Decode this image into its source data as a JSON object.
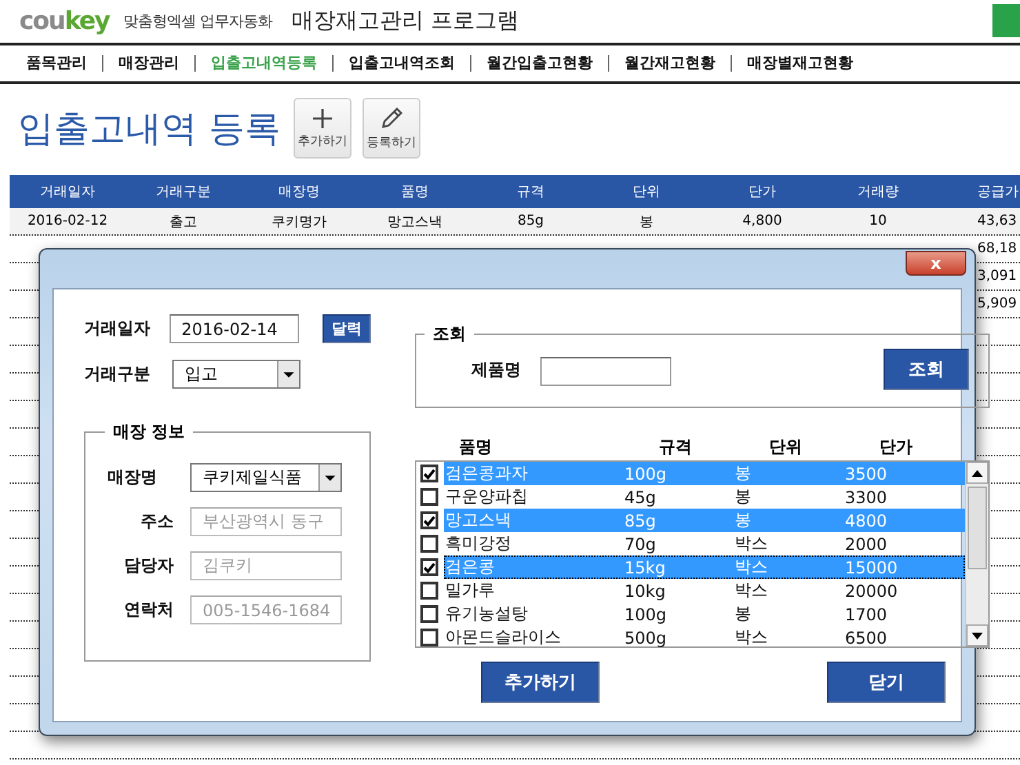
{
  "header": {
    "logo_gray": "cou",
    "logo_green": "key",
    "tagline": "맞춤형엑셀 업무자동화",
    "title": "매장재고관리 프로그램"
  },
  "nav": [
    {
      "label": "품목관리",
      "selected": false
    },
    {
      "label": "매장관리",
      "selected": false
    },
    {
      "label": "입출고내역등록",
      "selected": true
    },
    {
      "label": "입출고내역조회",
      "selected": false
    },
    {
      "label": "월간입출고현황",
      "selected": false
    },
    {
      "label": "월간재고현황",
      "selected": false
    },
    {
      "label": "매장별재고현황",
      "selected": false
    }
  ],
  "page_title": "입출고내역 등록",
  "toolbar": [
    {
      "kind": "add",
      "label": "추가하기"
    },
    {
      "kind": "edit",
      "label": "등록하기"
    }
  ],
  "table": {
    "columns": [
      "거래일자",
      "거래구분",
      "매장명",
      "품명",
      "규격",
      "단위",
      "단가",
      "거래량",
      "공급가"
    ],
    "rows": [
      {
        "cells": [
          "2016-02-12",
          "출고",
          "쿠키명가",
          "망고스낵",
          "85g",
          "봉",
          "4,800",
          "10",
          "43,63"
        ]
      },
      {
        "cells": [
          "",
          "",
          "",
          "",
          "",
          "",
          "",
          "",
          "68,18"
        ]
      },
      {
        "cells": [
          "",
          "",
          "",
          "",
          "",
          "",
          "",
          "",
          "3,091"
        ]
      },
      {
        "cells": [
          "",
          "",
          "",
          "",
          "",
          "",
          "",
          "",
          "5,909"
        ]
      }
    ]
  },
  "dialog": {
    "close": "x",
    "date": {
      "label": "거래일자",
      "value": "2016-02-14",
      "button": "달력"
    },
    "type": {
      "label": "거래구분",
      "value": "입고"
    },
    "store": {
      "legend": "매장 정보",
      "fields": [
        {
          "kind": "select",
          "label": "매장명",
          "value": "쿠키제일식품"
        },
        {
          "kind": "text",
          "label": "주소",
          "value": "부산광역시 동구",
          "disabled": true
        },
        {
          "kind": "text",
          "label": "담당자",
          "value": "김쿠키",
          "disabled": true
        },
        {
          "kind": "text",
          "label": "연락처",
          "value": "005-1546-1684",
          "disabled": true
        }
      ]
    },
    "search": {
      "legend": "조회",
      "label": "제품명",
      "button": "조회"
    },
    "list": {
      "columns": [
        "품명",
        "규격",
        "단위",
        "단가"
      ],
      "rows": [
        {
          "cells": [
            "검은콩과자",
            "100g",
            "봉",
            "3500"
          ],
          "checked": true,
          "selected": true,
          "focused": false
        },
        {
          "cells": [
            "구운양파칩",
            "45g",
            "봉",
            "3300"
          ],
          "checked": false,
          "selected": false,
          "focused": false
        },
        {
          "cells": [
            "망고스낵",
            "85g",
            "봉",
            "4800"
          ],
          "checked": true,
          "selected": true,
          "focused": false
        },
        {
          "cells": [
            "흑미강정",
            "70g",
            "박스",
            "2000"
          ],
          "checked": false,
          "selected": false,
          "focused": false
        },
        {
          "cells": [
            "검은콩",
            "15kg",
            "박스",
            "15000"
          ],
          "checked": true,
          "selected": true,
          "focused": true
        },
        {
          "cells": [
            "밀가루",
            "10kg",
            "박스",
            "20000"
          ],
          "checked": false,
          "selected": false,
          "focused": false
        },
        {
          "cells": [
            "유기농설탕",
            "100g",
            "봉",
            "1700"
          ],
          "checked": false,
          "selected": false,
          "focused": false
        },
        {
          "cells": [
            "아몬드슬라이스",
            "500g",
            "박스",
            "6500"
          ],
          "checked": false,
          "selected": false,
          "focused": false
        }
      ]
    },
    "buttons": [
      "추가하기",
      "닫기"
    ]
  }
}
